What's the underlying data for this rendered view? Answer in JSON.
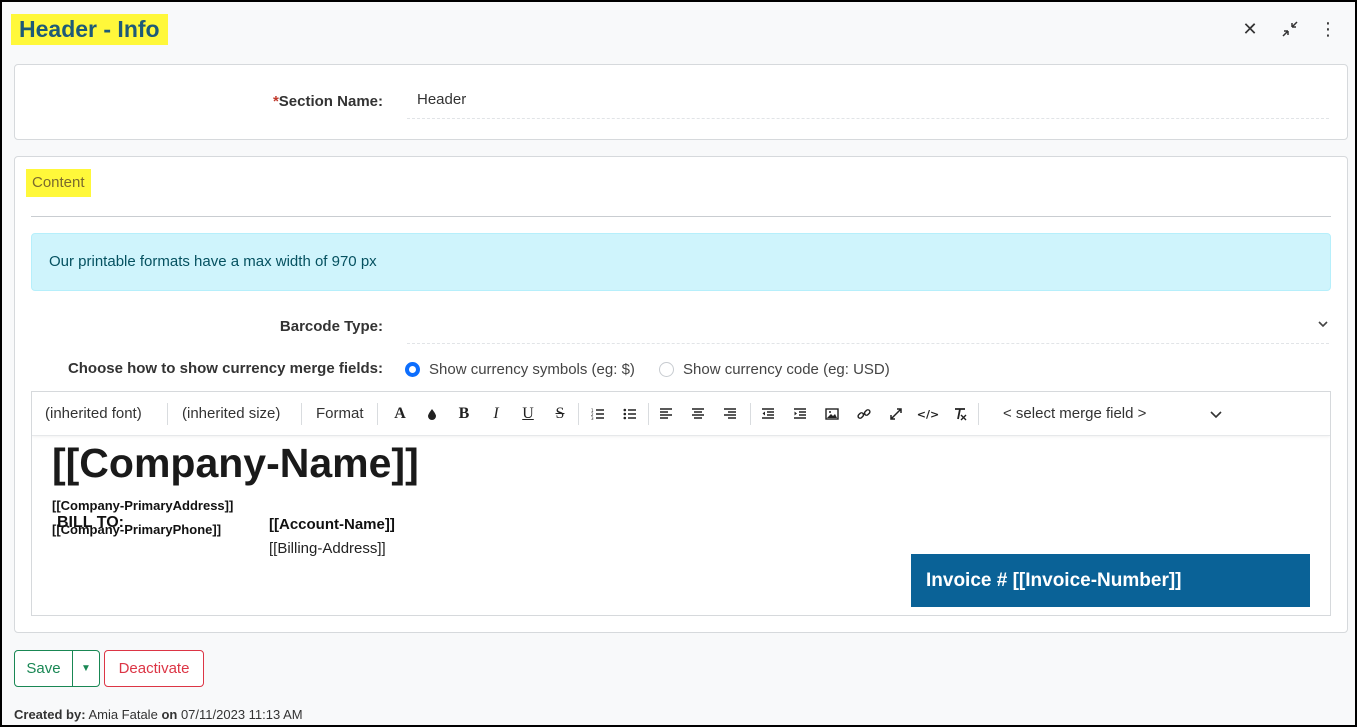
{
  "header": {
    "title": "Header - Info",
    "icons": [
      "close-icon",
      "collapse-icon",
      "more-vertical-icon"
    ]
  },
  "section": {
    "required_mark": "*",
    "name_label": "Section Name:",
    "name_value": "Header"
  },
  "content": {
    "label": "Content",
    "alert": "Our printable formats have a max width of 970 px",
    "barcode_label": "Barcode Type:",
    "barcode_value": "",
    "currency_label": "Choose how to show currency merge fields:",
    "currency_options": [
      {
        "label": "Show currency symbols (eg: $)",
        "selected": true
      },
      {
        "label": "Show currency code (eg: USD)",
        "selected": false
      }
    ]
  },
  "toolbar": {
    "font": "(inherited font)",
    "size": "(inherited size)",
    "format": "Format",
    "merge_field": "< select merge field >",
    "icons": [
      "font-color-icon",
      "highlight-color-icon",
      "bold-icon",
      "italic-icon",
      "underline-icon",
      "strikethrough-icon",
      "ordered-list-icon",
      "unordered-list-icon",
      "align-left-icon",
      "align-center-icon",
      "align-right-icon",
      "outdent-icon",
      "indent-icon",
      "image-icon",
      "link-icon",
      "fullscreen-icon",
      "code-view-icon",
      "clear-format-icon"
    ]
  },
  "editor": {
    "company_name": "[[Company-Name]]",
    "company_address": "[[Company-PrimaryAddress]]",
    "company_phone": "[[Company-PrimaryPhone]]",
    "bill_to": "BILL TO:",
    "account_name": "[[Account-Name]]",
    "billing_address": "[[Billing-Address]]",
    "invoice": "Invoice # [[Invoice-Number]]"
  },
  "actions": {
    "save": "Save",
    "deactivate": "Deactivate"
  },
  "footer": {
    "created_by_label": "Created by:",
    "created_by": "Amia Fatale",
    "on_label": "on",
    "created_on": "07/11/2023 11:13 AM"
  },
  "colors": {
    "highlight": "#fff83a",
    "title": "#1e5a78",
    "save_green": "#198754",
    "deactivate_red": "#dc3545",
    "invoice_blue": "#0a6297",
    "alert_bg": "#cff4fc"
  }
}
